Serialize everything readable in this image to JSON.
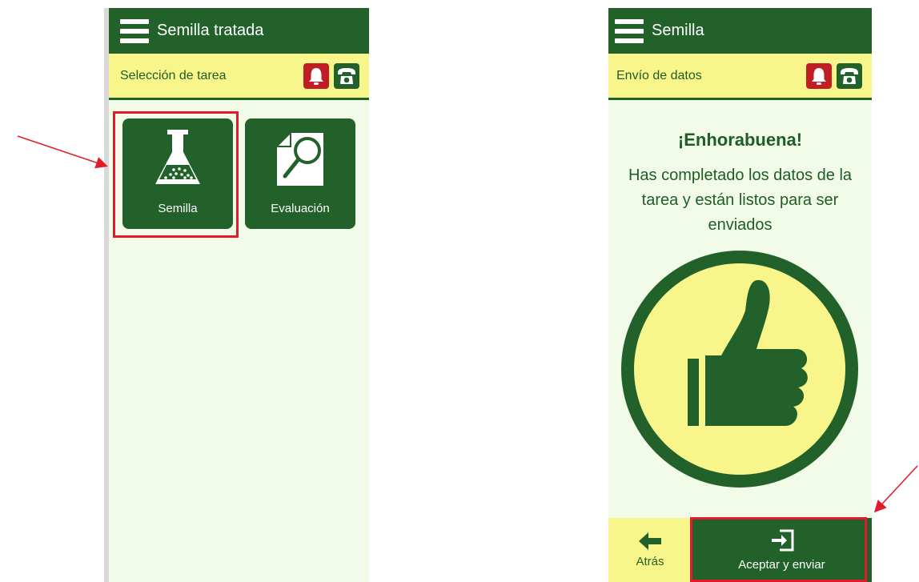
{
  "left_screen": {
    "header_title": "Semilla tratada",
    "subheader_label": "Selección de tarea",
    "tiles": [
      {
        "label": "Semilla",
        "icon": "flask-icon"
      },
      {
        "label": "Evaluación",
        "icon": "magnifier-icon"
      }
    ]
  },
  "right_screen": {
    "header_title": "Semilla",
    "subheader_label": "Envío de datos",
    "congrats_title": "¡Enhorabuena!",
    "congrats_text": "Has completado los datos de la tarea y están listos para ser enviados",
    "back_label": "Atrás",
    "accept_label": "Aceptar y enviar"
  },
  "colors": {
    "brand_green": "#22612a",
    "light_yellow": "#f8f68a",
    "alert_red": "#c01e24",
    "highlight_red": "#e21b2a",
    "background": "#f1fbe8"
  }
}
